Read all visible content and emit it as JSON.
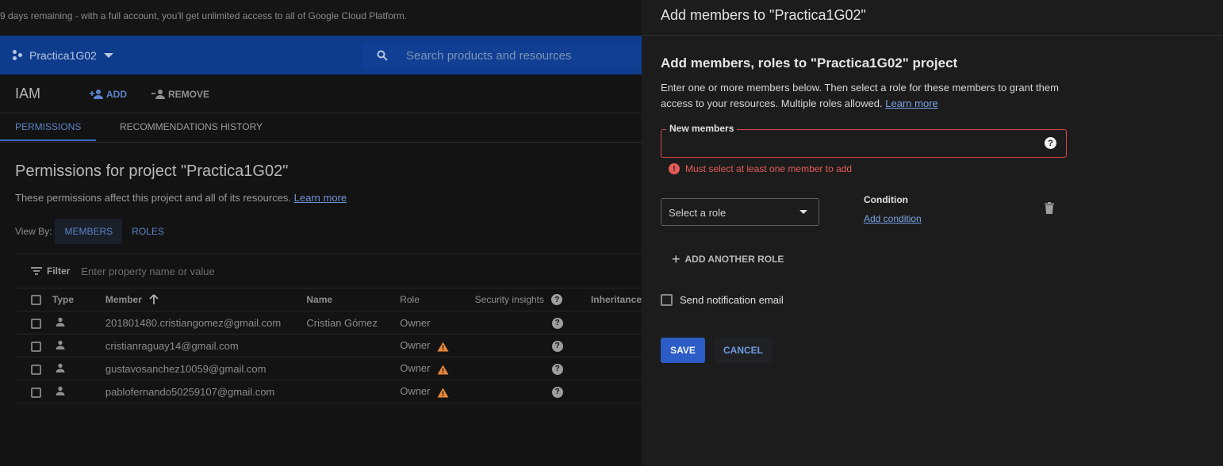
{
  "trial_banner": "9 days remaining - with a full account, you'll get unlimited access to all of Google Cloud Platform.",
  "topbar": {
    "project_name": "Practica1G02",
    "search_placeholder": "Search products and resources"
  },
  "iam": {
    "title": "IAM",
    "add_label": "ADD",
    "remove_label": "REMOVE",
    "tabs": [
      "PERMISSIONS",
      "RECOMMENDATIONS HISTORY"
    ],
    "permissions_title": "Permissions for project \"Practica1G02\"",
    "permissions_desc": "These permissions affect this project and all of its resources.",
    "learn_more": "Learn more",
    "view_by_label": "View By:",
    "view_by_options": [
      "MEMBERS",
      "ROLES"
    ],
    "filter_label": "Filter",
    "filter_placeholder": "Enter property name or value",
    "columns": {
      "type": "Type",
      "member": "Member",
      "name": "Name",
      "role": "Role",
      "security": "Security insights",
      "inheritance": "Inheritance"
    },
    "rows": [
      {
        "member": "201801480.cristiangomez@gmail.com",
        "name": "Cristian Gómez",
        "role": "Owner",
        "warning": false
      },
      {
        "member": "cristianraguay14@gmail.com",
        "name": "",
        "role": "Owner",
        "warning": true
      },
      {
        "member": "gustavosanchez10059@gmail.com",
        "name": "",
        "role": "Owner",
        "warning": true
      },
      {
        "member": "pablofernando50259107@gmail.com",
        "name": "",
        "role": "Owner",
        "warning": true
      }
    ]
  },
  "panel": {
    "header": "Add members to \"Practica1G02\"",
    "subtitle": "Add members, roles to \"Practica1G02\" project",
    "intro_line1": "Enter one or more members below. Then select a role for these members to grant them",
    "intro_line2": "access to your resources. Multiple roles allowed.",
    "learn_more": "Learn more",
    "new_members_label": "New members",
    "new_members_value": "",
    "error_text": "Must select at least one member to add",
    "role_select_value": "Select a role",
    "condition_label": "Condition",
    "add_condition": "Add condition",
    "add_another_role": "ADD ANOTHER ROLE",
    "send_notification": "Send notification email",
    "send_notification_checked": false,
    "save": "SAVE",
    "cancel": "CANCEL"
  },
  "colors": {
    "topbar_blue": "#0e3c8c",
    "accent_blue": "#2c5cc5",
    "error_red": "#d84a47",
    "warning_orange": "#e8873a"
  },
  "icons": [
    "project-dots-icon",
    "search-icon",
    "add-person-icon",
    "remove-person-icon",
    "filter-icon",
    "sort-arrow-up-icon",
    "help-icon",
    "person-icon",
    "warning-icon",
    "error-icon",
    "trash-icon",
    "plus-icon"
  ]
}
